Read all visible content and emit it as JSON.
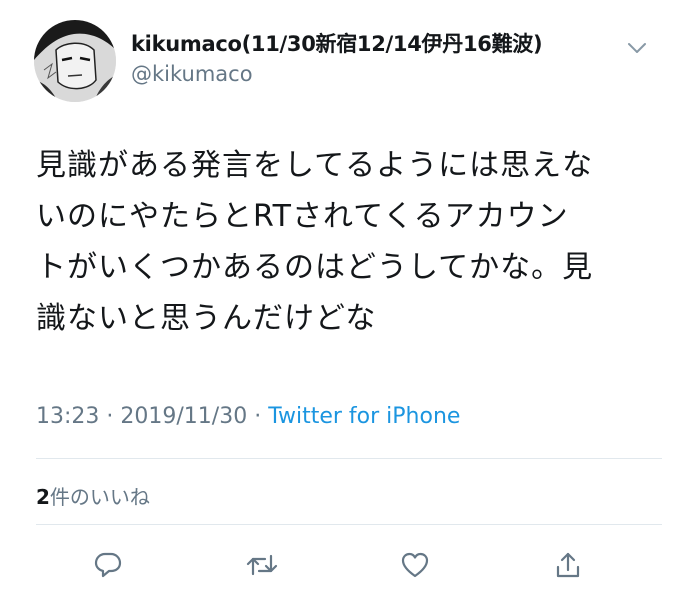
{
  "tweet": {
    "display_name": "kikumaco(11/30新宿12/14伊丹16難波)",
    "handle": "@kikumaco",
    "text": "見識がある発言をしてるようには思えな\nいのにやたらとRTされてくるアカウン\nトがいくつかあるのはどうしてかな。見\n識ないと思うんだけどな",
    "time": "13:23",
    "sep1": " · ",
    "date": "2019/11/30",
    "sep2": " · ",
    "source": "Twitter for iPhone",
    "likes_count": "2",
    "likes_label": "件のいいね"
  },
  "icons": {
    "caret": "chevron-down-icon",
    "reply": "reply-icon",
    "retweet": "retweet-icon",
    "like": "heart-icon",
    "share": "share-icon"
  },
  "colors": {
    "text": "#14171a",
    "secondary": "#657786",
    "link": "#1b95e0",
    "divider": "#e1e8ed"
  }
}
